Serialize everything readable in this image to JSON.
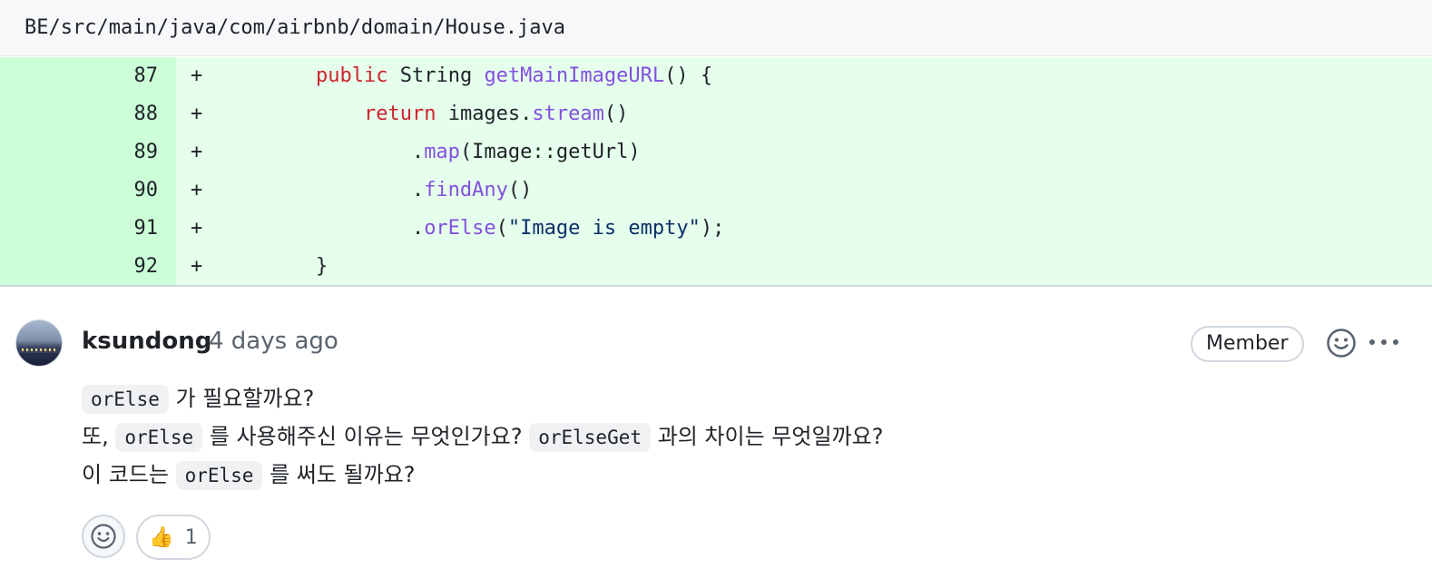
{
  "file": {
    "path": "BE/src/main/java/com/airbnb/domain/House.java"
  },
  "diff": {
    "lines": [
      {
        "number": "87",
        "marker": "+",
        "tokens": [
          {
            "t": "    ",
            "c": ""
          },
          {
            "t": "public",
            "c": "kw"
          },
          {
            "t": " String ",
            "c": ""
          },
          {
            "t": "getMainImageURL",
            "c": "fn"
          },
          {
            "t": "() {",
            "c": ""
          }
        ]
      },
      {
        "number": "88",
        "marker": "+",
        "tokens": [
          {
            "t": "        ",
            "c": ""
          },
          {
            "t": "return",
            "c": "kw"
          },
          {
            "t": " images.",
            "c": ""
          },
          {
            "t": "stream",
            "c": "fn"
          },
          {
            "t": "()",
            "c": ""
          }
        ]
      },
      {
        "number": "89",
        "marker": "+",
        "tokens": [
          {
            "t": "            .",
            "c": ""
          },
          {
            "t": "map",
            "c": "fn"
          },
          {
            "t": "(Image::getUrl)",
            "c": ""
          }
        ]
      },
      {
        "number": "90",
        "marker": "+",
        "tokens": [
          {
            "t": "            .",
            "c": ""
          },
          {
            "t": "findAny",
            "c": "fn"
          },
          {
            "t": "()",
            "c": ""
          }
        ]
      },
      {
        "number": "91",
        "marker": "+",
        "tokens": [
          {
            "t": "            .",
            "c": ""
          },
          {
            "t": "orElse",
            "c": "fn"
          },
          {
            "t": "(",
            "c": ""
          },
          {
            "t": "\"Image is empty\"",
            "c": "str"
          },
          {
            "t": ");",
            "c": ""
          }
        ]
      },
      {
        "number": "92",
        "marker": "+",
        "tokens": [
          {
            "t": "    }",
            "c": ""
          }
        ]
      }
    ]
  },
  "comment": {
    "author": "ksundong",
    "time": "4 days ago",
    "badge": "Member",
    "body_lines": [
      [
        {
          "t": "orElse",
          "code": true
        },
        {
          "t": " 가 필요할까요?",
          "code": false
        }
      ],
      [
        {
          "t": "또, ",
          "code": false
        },
        {
          "t": "orElse",
          "code": true
        },
        {
          "t": " 를 사용해주신 이유는 무엇인가요? ",
          "code": false
        },
        {
          "t": "orElseGet",
          "code": true
        },
        {
          "t": " 과의 차이는 무엇일까요?",
          "code": false
        }
      ],
      [
        {
          "t": "이 코드는 ",
          "code": false
        },
        {
          "t": "orElse",
          "code": true
        },
        {
          "t": " 를 써도 될까요?",
          "code": false
        }
      ]
    ],
    "reactions": {
      "thumbs_emoji": "👍",
      "thumbs_count": "1"
    },
    "icons": [
      "smiley-icon",
      "kebab-icon",
      "add-reaction-icon",
      "thumbs-up-icon"
    ]
  },
  "colors": {
    "added_bg": "#e6ffec",
    "added_gutter": "#ccffd8",
    "keyword": "#cf222e",
    "function": "#8250df",
    "string": "#0a3069"
  }
}
